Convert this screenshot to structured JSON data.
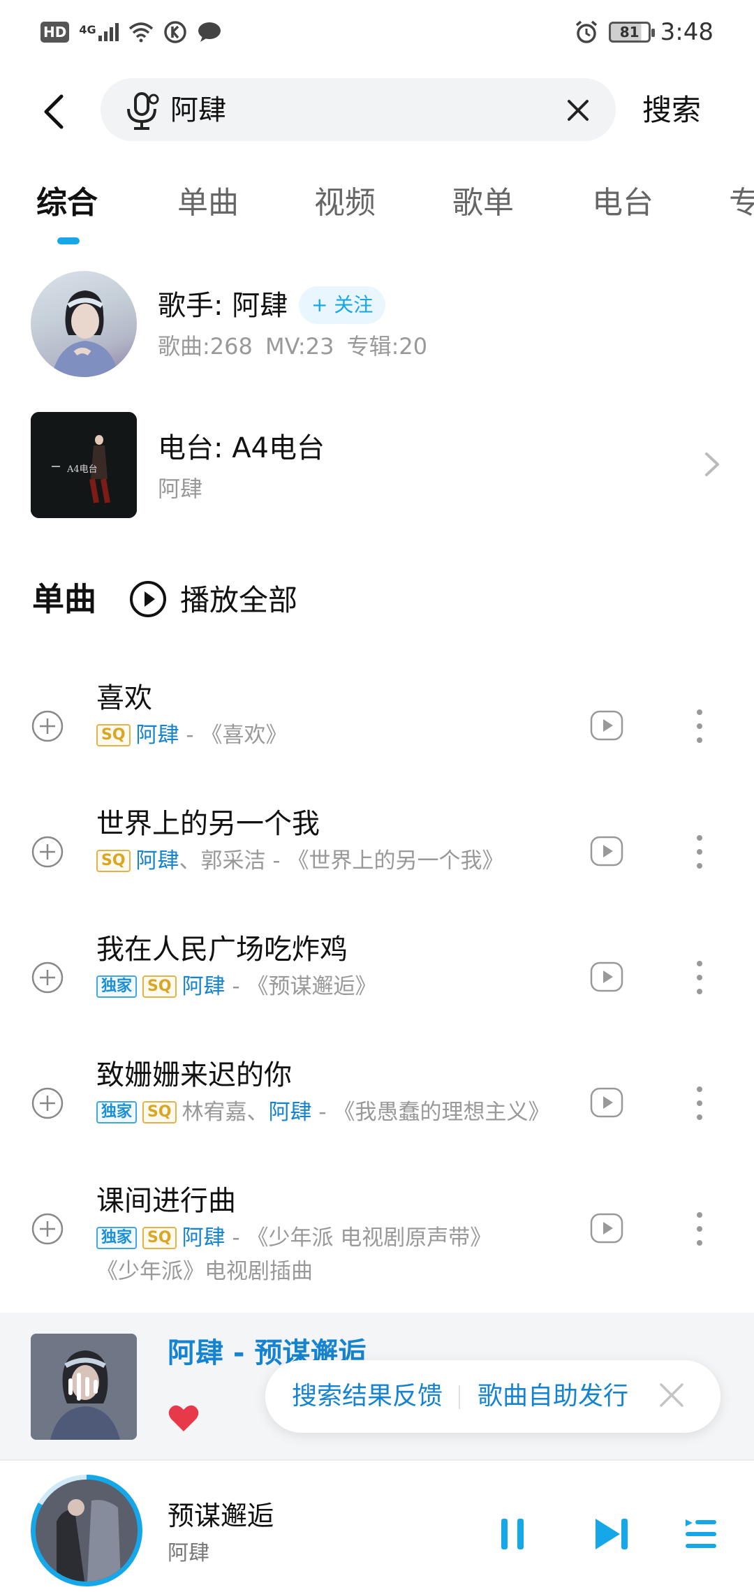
{
  "status_bar": {
    "network": "4G",
    "hd": "HD",
    "battery": "81",
    "time": "3:48"
  },
  "search": {
    "query": "阿肆",
    "search_button": "搜索"
  },
  "tabs": [
    {
      "label": "综合",
      "active": true
    },
    {
      "label": "单曲",
      "active": false
    },
    {
      "label": "视频",
      "active": false
    },
    {
      "label": "歌单",
      "active": false
    },
    {
      "label": "电台",
      "active": false
    },
    {
      "label": "专",
      "active": false
    }
  ],
  "artist": {
    "name": "歌手: 阿肆",
    "follow": "+ 关注",
    "stats": "歌曲:268 MV:23 专辑:20"
  },
  "radio": {
    "title": "电台: A4电台",
    "subtitle": "阿肆",
    "cover_text": "A4电台"
  },
  "songs_section": {
    "title": "单曲",
    "play_all": "播放全部"
  },
  "badges": {
    "sq": "SQ",
    "exclusive": "独家"
  },
  "songs": [
    {
      "title": "喜欢",
      "exclusive": false,
      "artists_pre": "",
      "artist": "阿肆",
      "artists_post": "",
      "album": " - 《喜欢》",
      "extra": ""
    },
    {
      "title": "世界上的另一个我",
      "exclusive": false,
      "artists_pre": "",
      "artist": "阿肆",
      "artists_post": "、郭采洁",
      "album": " - 《世界上的另一个我》",
      "extra": ""
    },
    {
      "title": "我在人民广场吃炸鸡",
      "exclusive": true,
      "artists_pre": "",
      "artist": "阿肆",
      "artists_post": "",
      "album": " - 《预谋邂逅》",
      "extra": ""
    },
    {
      "title": "致姗姗来迟的你",
      "exclusive": true,
      "artists_pre": "林宥嘉、",
      "artist": "阿肆",
      "artists_post": "",
      "album": " - 《我愚蠢的理想主义》",
      "extra": ""
    },
    {
      "title": "课间进行曲",
      "exclusive": true,
      "artists_pre": "",
      "artist": "阿肆",
      "artists_post": "",
      "album": " - 《少年派 电视剧原声带》",
      "extra": "《少年派》电视剧插曲"
    }
  ],
  "mini_card": {
    "title": "阿肆 - 预谋邂逅"
  },
  "feedback": {
    "search_feedback": "搜索结果反馈",
    "self_publish": "歌曲自助发行"
  },
  "now_playing": {
    "title": "预谋邂逅",
    "artist": "阿肆"
  },
  "colors": {
    "accent": "#16a7e8",
    "link": "#1583cf",
    "sq_badge": "#d9a623",
    "heart": "#e8394a"
  }
}
